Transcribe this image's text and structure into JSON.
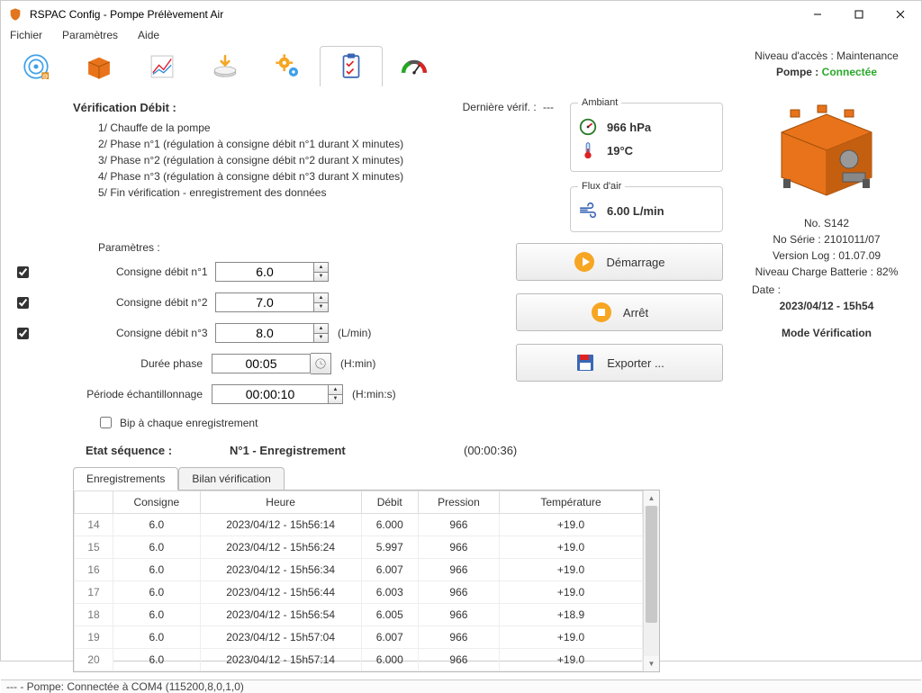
{
  "window": {
    "title": "RSPAC Config - Pompe Prélèvement Air"
  },
  "menu": {
    "file": "Fichier",
    "settings": "Paramètres",
    "help": "Aide"
  },
  "toolbar_icons": [
    "target-icon",
    "box-icon",
    "chart-icon",
    "disk-arrow-icon",
    "gears-icon",
    "clipboard-check-icon",
    "gauge-icon"
  ],
  "verification": {
    "title": "Vérification Débit :",
    "steps": [
      "1/ Chauffe de la pompe",
      "2/ Phase n°1 (régulation à consigne débit n°1 durant X minutes)",
      "3/ Phase n°2 (régulation à consigne débit n°2 durant X minutes)",
      "4/ Phase n°3 (régulation à consigne débit n°3 durant X minutes)",
      "5/ Fin vérification - enregistrement des données"
    ],
    "last_check_label": "Dernière vérif. :",
    "last_check_value": "---"
  },
  "params": {
    "section_label": "Paramètres :",
    "consigne_labels": [
      "Consigne débit n°1",
      "Consigne débit n°2",
      "Consigne débit n°3"
    ],
    "consigne_values": [
      "6.0",
      "7.0",
      "8.0"
    ],
    "flow_unit": "(L/min)",
    "phase_duration_label": "Durée phase",
    "phase_duration_value": "00:05",
    "phase_duration_unit": "(H:min)",
    "sampling_label": "Période échantillonnage",
    "sampling_value": "00:00:10",
    "sampling_unit": "(H:min:s)",
    "beep_label": "Bip à chaque enregistrement"
  },
  "ambient": {
    "legend": "Ambiant",
    "pressure": "966 hPa",
    "temperature": "19°C"
  },
  "airflow": {
    "legend": "Flux d'air",
    "value": "6.00 L/min"
  },
  "actions": {
    "start": "Démarrage",
    "stop": "Arrêt",
    "export": "Exporter ..."
  },
  "state": {
    "label": "Etat séquence :",
    "value": "N°1 - Enregistrement",
    "elapsed": "(00:00:36)"
  },
  "tabs": {
    "recordings": "Enregistrements",
    "report": "Bilan vérification"
  },
  "table": {
    "headers": [
      "Consigne",
      "Heure",
      "Débit",
      "Pression",
      "Température"
    ],
    "rows": [
      {
        "n": "14",
        "c": "6.0",
        "h": "2023/04/12 - 15h56:14",
        "d": "6.000",
        "p": "966",
        "t": "+19.0"
      },
      {
        "n": "15",
        "c": "6.0",
        "h": "2023/04/12 - 15h56:24",
        "d": "5.997",
        "p": "966",
        "t": "+19.0"
      },
      {
        "n": "16",
        "c": "6.0",
        "h": "2023/04/12 - 15h56:34",
        "d": "6.007",
        "p": "966",
        "t": "+19.0"
      },
      {
        "n": "17",
        "c": "6.0",
        "h": "2023/04/12 - 15h56:44",
        "d": "6.003",
        "p": "966",
        "t": "+19.0"
      },
      {
        "n": "18",
        "c": "6.0",
        "h": "2023/04/12 - 15h56:54",
        "d": "6.005",
        "p": "966",
        "t": "+18.9"
      },
      {
        "n": "19",
        "c": "6.0",
        "h": "2023/04/12 - 15h57:04",
        "d": "6.007",
        "p": "966",
        "t": "+19.0"
      },
      {
        "n": "20",
        "c": "6.0",
        "h": "2023/04/12 - 15h57:14",
        "d": "6.000",
        "p": "966",
        "t": "+19.0"
      }
    ]
  },
  "right": {
    "access_label": "Niveau d'accès :",
    "access_value": "Maintenance",
    "pump_label": "Pompe :",
    "pump_status": "Connectée",
    "device_no_label": "No.",
    "device_no": "S142",
    "serial_label": "No Série :",
    "serial": "2101011/07",
    "version_label": "Version Log :",
    "version": "01.07.09",
    "battery_label": "Niveau Charge Batterie :",
    "battery": "82%",
    "date_label": "Date :",
    "datetime": "2023/04/12 - 15h54",
    "mode": "Mode Vérification"
  },
  "statusbar": "--- - Pompe: Connectée à COM4 (115200,8,0,1,0)"
}
